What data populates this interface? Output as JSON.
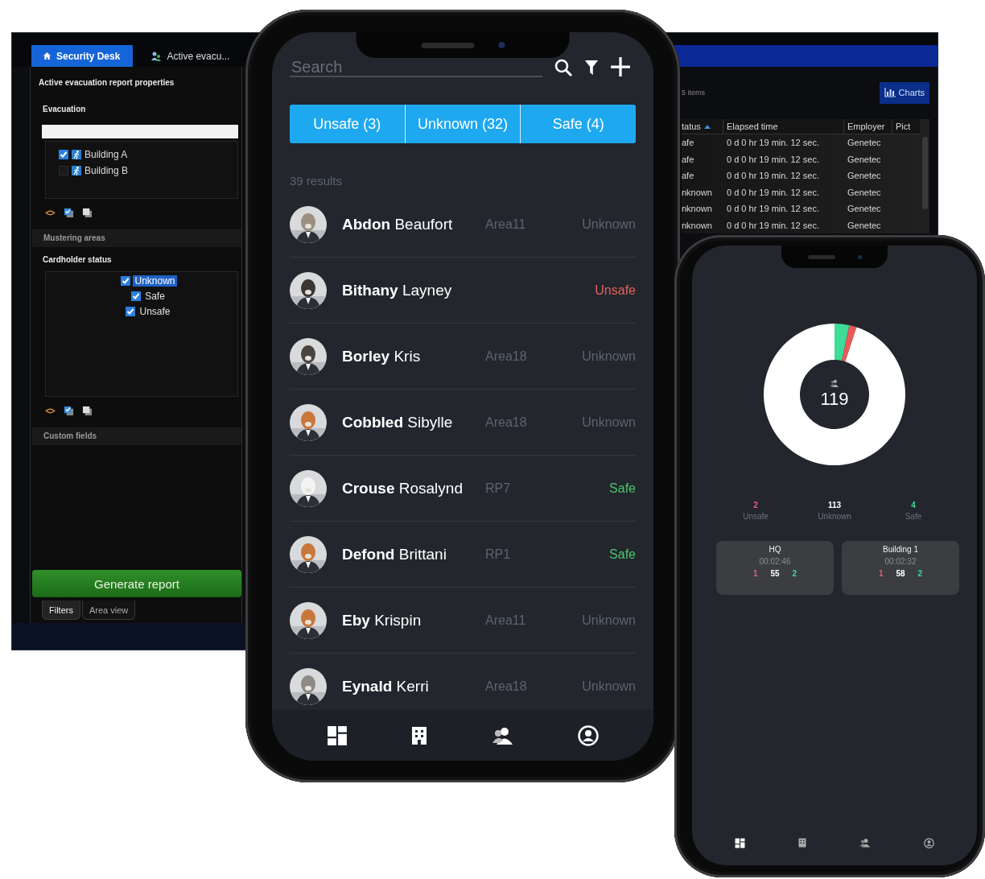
{
  "desktop": {
    "tabs": [
      {
        "label": "Security Desk",
        "selected": true
      },
      {
        "label": "Active evacu...",
        "selected": false
      }
    ],
    "panel_title": "Active evacuation report properties",
    "evacuation": {
      "header": "Evacuation",
      "items": [
        {
          "label": "Building A",
          "checked": true
        },
        {
          "label": "Building B",
          "checked": false
        }
      ]
    },
    "mustering_header": "Mustering areas",
    "cardholder_status": {
      "header": "Cardholder status",
      "items": [
        {
          "label": "Unknown",
          "checked": true,
          "selected": true
        },
        {
          "label": "Safe",
          "checked": true,
          "selected": false
        },
        {
          "label": "Unsafe",
          "checked": true,
          "selected": false
        }
      ]
    },
    "custom_fields_header": "Custom fields",
    "generate_button": "Generate report",
    "bottom_tabs": [
      {
        "label": "Filters",
        "selected": true
      },
      {
        "label": "Area view",
        "selected": false
      }
    ],
    "results": {
      "count": "5 items",
      "charts_button": "Charts",
      "columns": [
        "tatus",
        "Elapsed time",
        "Employer",
        "Pict"
      ],
      "rows": [
        [
          "afe",
          "0 d 0 hr 19 min. 12 sec.",
          "Genetec"
        ],
        [
          "afe",
          "0 d 0 hr 19 min. 12 sec.",
          "Genetec"
        ],
        [
          "afe",
          "0 d 0 hr 19 min. 12 sec.",
          "Genetec"
        ],
        [
          "nknown",
          "0 d 0 hr 19 min. 12 sec.",
          "Genetec"
        ],
        [
          "nknown",
          "0 d 0 hr 19 min. 12 sec.",
          "Genetec"
        ],
        [
          "nknown",
          "0 d 0 hr 19 min. 12 sec.",
          "Genetec"
        ]
      ]
    }
  },
  "phone_list": {
    "search": {
      "placeholder": "Search"
    },
    "segments": [
      "Unsafe (3)",
      "Unknown (32)",
      "Safe (4)"
    ],
    "results_count": "39 results",
    "people": [
      {
        "name": "**Abdon** Beaufort",
        "area": "Area11",
        "status": "Unknown",
        "kind": "unknown"
      },
      {
        "name": "**Bithany** Layney",
        "status": "Unsafe",
        "kind": "unsafe"
      },
      {
        "name": "**Borley** Kris",
        "area": "Area18",
        "status": "Unknown",
        "kind": "unknown"
      },
      {
        "name": "**Cobbled** Sibylle",
        "area": "Area18",
        "status": "Unknown",
        "kind": "unknown"
      },
      {
        "name": "**Crouse** Rosalynd",
        "area": "RP7",
        "status": "Safe",
        "kind": "safe"
      },
      {
        "name": "**Defond** Brittani",
        "area": "RP1",
        "status": "Safe",
        "kind": "safe"
      },
      {
        "name": "**Eby** Krispin",
        "area": "Area11",
        "status": "Unknown",
        "kind": "unknown"
      },
      {
        "name": "**Eynald** Kerri",
        "area": "Area18",
        "status": "Unknown",
        "kind": "unknown"
      }
    ]
  },
  "phone_dashboard": {
    "total": "119",
    "stats": [
      {
        "value": "2",
        "label": "Unsafe",
        "kind": "unsafe"
      },
      {
        "value": "113",
        "label": "Unknown",
        "kind": "unknown"
      },
      {
        "value": "4",
        "label": "Safe",
        "kind": "safe"
      }
    ],
    "areas": [
      {
        "name": "HQ",
        "time": "00:02:46",
        "unsafe": "1",
        "unknown": "55",
        "safe": "2"
      },
      {
        "name": "Building 1",
        "time": "00:02:32",
        "unsafe": "1",
        "unknown": "58",
        "safe": "2"
      }
    ]
  }
}
